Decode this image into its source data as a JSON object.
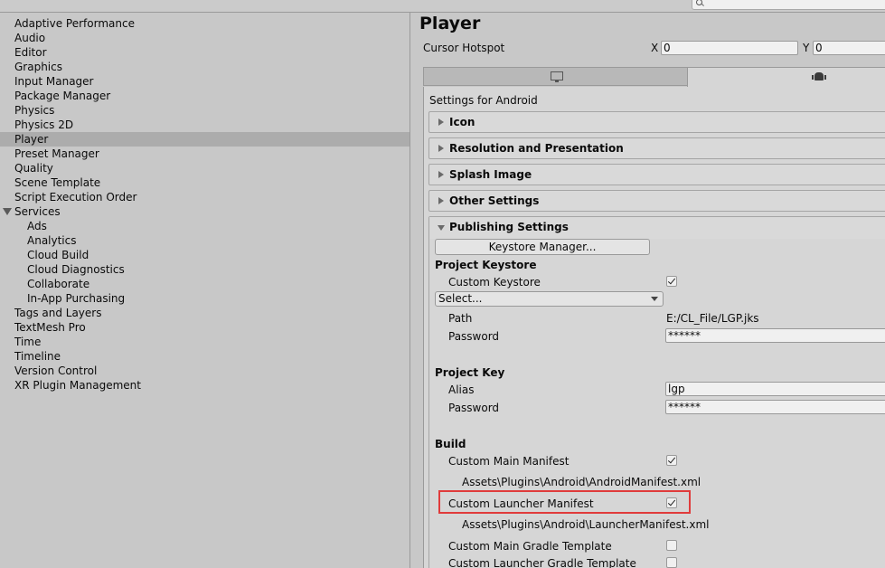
{
  "search": {
    "placeholder": ""
  },
  "sidebar": {
    "items": [
      "Adaptive Performance",
      "Audio",
      "Editor",
      "Graphics",
      "Input Manager",
      "Package Manager",
      "Physics",
      "Physics 2D",
      "Player",
      "Preset Manager",
      "Quality",
      "Scene Template",
      "Script Execution Order",
      "Services",
      "Ads",
      "Analytics",
      "Cloud Build",
      "Cloud Diagnostics",
      "Collaborate",
      "In-App Purchasing",
      "Tags and Layers",
      "TextMesh Pro",
      "Time",
      "Timeline",
      "Version Control",
      "XR Plugin Management"
    ],
    "selected": "Player"
  },
  "inspector": {
    "title": "Player",
    "cursor_hotspot": {
      "label": "Cursor Hotspot",
      "x_label": "X",
      "x_value": "0",
      "y_label": "Y",
      "y_value": "0"
    },
    "settings_for": "Settings for Android",
    "sections": {
      "icon": "Icon",
      "resolution": "Resolution and Presentation",
      "splash": "Splash Image",
      "other": "Other Settings",
      "publishing": "Publishing Settings"
    },
    "publishing": {
      "keystore_manager": "Keystore Manager...",
      "project_keystore": "Project Keystore",
      "custom_keystore": "Custom Keystore",
      "select": "Select...",
      "path_label": "Path",
      "path_value": "E:/CL_File/LGP.jks",
      "password_label": "Password",
      "password_value": "******",
      "project_key": "Project Key",
      "alias_label": "Alias",
      "alias_value": "lgp",
      "key_password_label": "Password",
      "key_password_value": "******",
      "build": "Build",
      "custom_main_manifest": "Custom Main Manifest",
      "main_manifest_path": "Assets\\Plugins\\Android\\AndroidManifest.xml",
      "custom_launcher_manifest": "Custom Launcher Manifest",
      "launcher_manifest_path": "Assets\\Plugins\\Android\\LauncherManifest.xml",
      "custom_main_gradle": "Custom Main Gradle Template",
      "custom_launcher_gradle": "Custom Launcher Gradle Template"
    }
  },
  "colors": {
    "highlight": "#e03b3b",
    "selected_row": "#acacac"
  }
}
